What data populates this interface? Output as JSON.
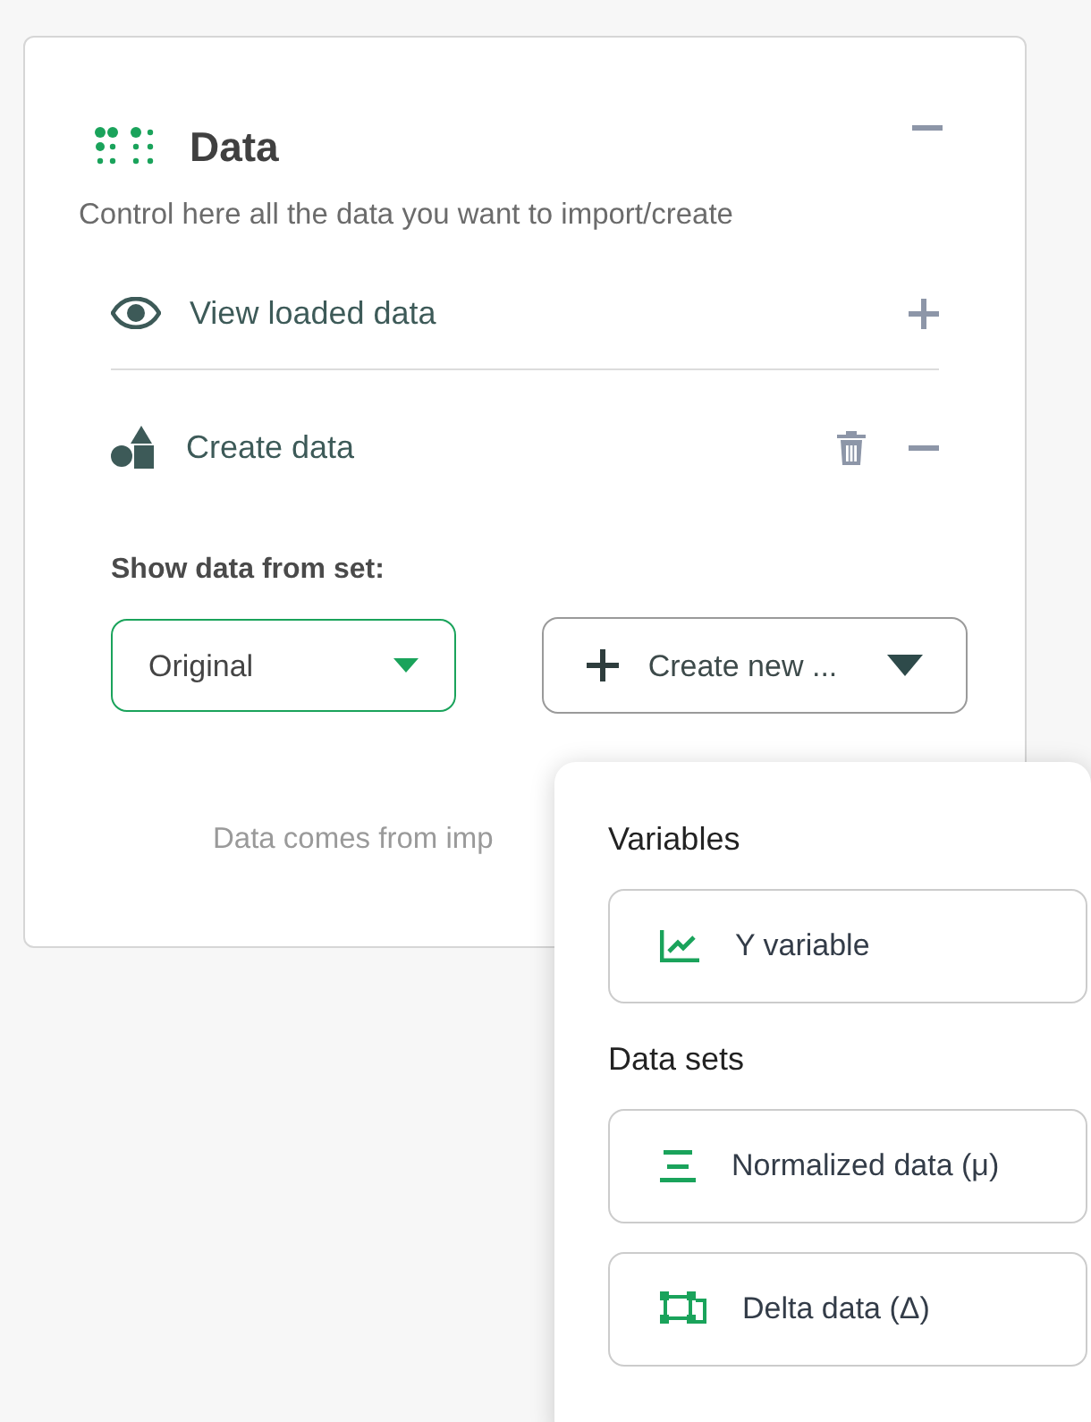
{
  "panel": {
    "title": "Data",
    "expanded": true,
    "description": "Control here all the data you want to import/create",
    "sections": [
      {
        "label": "View loaded data",
        "expanded": false,
        "deletable": false
      },
      {
        "label": "Create data",
        "expanded": true,
        "deletable": true
      }
    ],
    "set_label": "Show data from set:",
    "set_select": {
      "value": "Original"
    },
    "create_button": {
      "label": "Create new ..."
    },
    "footer": "Data comes from imp"
  },
  "menu": {
    "groups": [
      {
        "heading": "Variables",
        "items": [
          {
            "label": "Y variable"
          }
        ]
      },
      {
        "heading": "Data sets",
        "items": [
          {
            "label": "Normalized data (μ)"
          },
          {
            "label": "Delta data (Δ)"
          }
        ]
      }
    ]
  }
}
